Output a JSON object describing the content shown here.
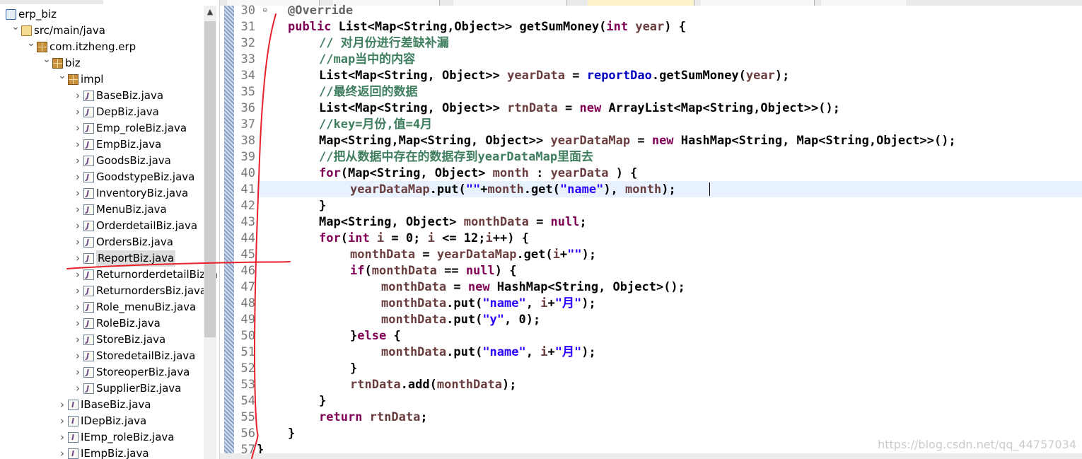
{
  "explorer": {
    "items": [
      {
        "label": "erp_biz",
        "icon": "project-icon",
        "depth": 0,
        "twisty": ""
      },
      {
        "label": "src/main/java",
        "icon": "source-folder-icon",
        "depth": 1,
        "twisty": "expanded"
      },
      {
        "label": "com.itzheng.erp",
        "icon": "package-icon",
        "depth": 2,
        "twisty": "expanded"
      },
      {
        "label": "biz",
        "icon": "package-icon",
        "depth": 3,
        "twisty": "expanded"
      },
      {
        "label": "impl",
        "icon": "package-icon",
        "depth": 4,
        "twisty": "expanded"
      },
      {
        "label": "BaseBiz.java",
        "icon": "java-file-icon",
        "depth": 5,
        "twisty": "collapsed"
      },
      {
        "label": "DepBiz.java",
        "icon": "java-file-icon",
        "depth": 5,
        "twisty": "collapsed"
      },
      {
        "label": "Emp_roleBiz.java",
        "icon": "java-file-icon",
        "depth": 5,
        "twisty": "collapsed"
      },
      {
        "label": "EmpBiz.java",
        "icon": "java-file-icon",
        "depth": 5,
        "twisty": "collapsed"
      },
      {
        "label": "GoodsBiz.java",
        "icon": "java-file-icon",
        "depth": 5,
        "twisty": "collapsed"
      },
      {
        "label": "GoodstypeBiz.java",
        "icon": "java-file-icon",
        "depth": 5,
        "twisty": "collapsed"
      },
      {
        "label": "InventoryBiz.java",
        "icon": "java-file-icon",
        "depth": 5,
        "twisty": "collapsed"
      },
      {
        "label": "MenuBiz.java",
        "icon": "java-file-icon",
        "depth": 5,
        "twisty": "collapsed"
      },
      {
        "label": "OrderdetailBiz.java",
        "icon": "java-file-icon",
        "depth": 5,
        "twisty": "collapsed"
      },
      {
        "label": "OrdersBiz.java",
        "icon": "java-file-icon",
        "depth": 5,
        "twisty": "collapsed"
      },
      {
        "label": "ReportBiz.java",
        "icon": "java-file-icon",
        "depth": 5,
        "twisty": "collapsed",
        "selected": true
      },
      {
        "label": "ReturnorderdetailBiz.ja",
        "icon": "java-file-icon",
        "depth": 5,
        "twisty": "collapsed"
      },
      {
        "label": "ReturnordersBiz.java",
        "icon": "java-file-icon",
        "depth": 5,
        "twisty": "collapsed"
      },
      {
        "label": "Role_menuBiz.java",
        "icon": "java-file-icon",
        "depth": 5,
        "twisty": "collapsed"
      },
      {
        "label": "RoleBiz.java",
        "icon": "java-file-icon",
        "depth": 5,
        "twisty": "collapsed"
      },
      {
        "label": "StoreBiz.java",
        "icon": "java-file-icon",
        "depth": 5,
        "twisty": "collapsed"
      },
      {
        "label": "StoredetailBiz.java",
        "icon": "java-file-icon",
        "depth": 5,
        "twisty": "collapsed"
      },
      {
        "label": "StoreoperBiz.java",
        "icon": "java-file-icon",
        "depth": 5,
        "twisty": "collapsed"
      },
      {
        "label": "SupplierBiz.java",
        "icon": "java-file-icon",
        "depth": 5,
        "twisty": "collapsed"
      },
      {
        "label": "IBaseBiz.java",
        "icon": "interface-file-icon",
        "depth": 4,
        "twisty": "collapsed"
      },
      {
        "label": "IDepBiz.java",
        "icon": "interface-file-icon",
        "depth": 4,
        "twisty": "collapsed"
      },
      {
        "label": "IEmp_roleBiz.java",
        "icon": "interface-file-icon",
        "depth": 4,
        "twisty": "collapsed"
      },
      {
        "label": "IEmpBiz.java",
        "icon": "interface-file-icon",
        "depth": 4,
        "twisty": "collapsed"
      }
    ]
  },
  "editor": {
    "line_numbers": [
      "30",
      "31",
      "32",
      "33",
      "34",
      "35",
      "36",
      "37",
      "38",
      "39",
      "40",
      "41",
      "42",
      "43",
      "44",
      "45",
      "46",
      "47",
      "48",
      "49",
      "50",
      "51",
      "52",
      "53",
      "54",
      "55",
      "56",
      "57"
    ],
    "fold_markers": {
      "30": "⊖"
    },
    "current_line": "41",
    "lines": [
      {
        "indent": 1,
        "tokens": [
          {
            "t": "an",
            "v": "@Override"
          }
        ]
      },
      {
        "indent": 1,
        "tokens": [
          {
            "t": "kw",
            "v": "public"
          },
          {
            "t": "",
            "v": " List<Map<String,Object>> getSumMoney("
          },
          {
            "t": "kw",
            "v": "int"
          },
          {
            "t": "",
            "v": " "
          },
          {
            "t": "lv",
            "v": "year"
          },
          {
            "t": "",
            "v": ") {"
          }
        ]
      },
      {
        "indent": 2,
        "tokens": [
          {
            "t": "cm",
            "v": "// 对月份进行差缺补漏"
          }
        ]
      },
      {
        "indent": 2,
        "tokens": [
          {
            "t": "cm",
            "v": "//map当中的内容"
          }
        ]
      },
      {
        "indent": 2,
        "tokens": [
          {
            "t": "",
            "v": "List<Map<String, Object>> "
          },
          {
            "t": "lv",
            "v": "yearData"
          },
          {
            "t": "",
            "v": " = "
          },
          {
            "t": "fd",
            "v": "reportDao"
          },
          {
            "t": "",
            "v": ".getSumMoney("
          },
          {
            "t": "lv",
            "v": "year"
          },
          {
            "t": "",
            "v": ");"
          }
        ]
      },
      {
        "indent": 2,
        "tokens": [
          {
            "t": "cm",
            "v": "//最终返回的数据"
          }
        ]
      },
      {
        "indent": 2,
        "tokens": [
          {
            "t": "",
            "v": "List<Map<String, Object>> "
          },
          {
            "t": "lv",
            "v": "rtnData"
          },
          {
            "t": "",
            "v": " = "
          },
          {
            "t": "kw",
            "v": "new"
          },
          {
            "t": "",
            "v": " ArrayList<Map<String,Object>>();"
          }
        ]
      },
      {
        "indent": 2,
        "tokens": [
          {
            "t": "cm",
            "v": "//key=月份,值=4月"
          }
        ]
      },
      {
        "indent": 2,
        "tokens": [
          {
            "t": "",
            "v": "Map<String,Map<String, Object>> "
          },
          {
            "t": "lv",
            "v": "yearDataMap"
          },
          {
            "t": "",
            "v": " = "
          },
          {
            "t": "kw",
            "v": "new"
          },
          {
            "t": "",
            "v": " HashMap<String, Map<String,Object>>();"
          }
        ]
      },
      {
        "indent": 2,
        "tokens": [
          {
            "t": "cm",
            "v": "//把从数据中存在的数据存到yearDataMap里面去"
          }
        ]
      },
      {
        "indent": 2,
        "tokens": [
          {
            "t": "kw",
            "v": "for"
          },
          {
            "t": "",
            "v": "(Map<String, Object> "
          },
          {
            "t": "lv",
            "v": "month"
          },
          {
            "t": "",
            "v": " : "
          },
          {
            "t": "lv",
            "v": "yearData"
          },
          {
            "t": "",
            "v": " ) {"
          }
        ]
      },
      {
        "indent": 3,
        "tokens": [
          {
            "t": "lv",
            "v": "yearDataMap"
          },
          {
            "t": "",
            "v": ".put("
          },
          {
            "t": "st",
            "v": "\"\""
          },
          {
            "t": "",
            "v": "+"
          },
          {
            "t": "lv",
            "v": "month"
          },
          {
            "t": "",
            "v": ".get("
          },
          {
            "t": "st",
            "v": "\"name\""
          },
          {
            "t": "",
            "v": "), "
          },
          {
            "t": "lv",
            "v": "month"
          },
          {
            "t": "",
            "v": ");"
          }
        ]
      },
      {
        "indent": 2,
        "tokens": [
          {
            "t": "",
            "v": "}"
          }
        ]
      },
      {
        "indent": 2,
        "tokens": [
          {
            "t": "",
            "v": "Map<String, Object> "
          },
          {
            "t": "lv",
            "v": "monthData"
          },
          {
            "t": "",
            "v": " = "
          },
          {
            "t": "kw",
            "v": "null"
          },
          {
            "t": "",
            "v": ";"
          }
        ]
      },
      {
        "indent": 2,
        "tokens": [
          {
            "t": "kw",
            "v": "for"
          },
          {
            "t": "",
            "v": "("
          },
          {
            "t": "kw",
            "v": "int"
          },
          {
            "t": "",
            "v": " "
          },
          {
            "t": "lv",
            "v": "i"
          },
          {
            "t": "",
            "v": " = 0; "
          },
          {
            "t": "lv",
            "v": "i"
          },
          {
            "t": "",
            "v": " <= 12;"
          },
          {
            "t": "lv",
            "v": "i"
          },
          {
            "t": "",
            "v": "++) {"
          }
        ]
      },
      {
        "indent": 3,
        "tokens": [
          {
            "t": "lv",
            "v": "monthData"
          },
          {
            "t": "",
            "v": " = "
          },
          {
            "t": "lv",
            "v": "yearDataMap"
          },
          {
            "t": "",
            "v": ".get("
          },
          {
            "t": "lv",
            "v": "i"
          },
          {
            "t": "",
            "v": "+"
          },
          {
            "t": "st",
            "v": "\"\""
          },
          {
            "t": "",
            "v": ");"
          }
        ]
      },
      {
        "indent": 3,
        "tokens": [
          {
            "t": "kw",
            "v": "if"
          },
          {
            "t": "",
            "v": "("
          },
          {
            "t": "lv",
            "v": "monthData"
          },
          {
            "t": "",
            "v": " == "
          },
          {
            "t": "kw",
            "v": "null"
          },
          {
            "t": "",
            "v": ") {"
          }
        ]
      },
      {
        "indent": 4,
        "tokens": [
          {
            "t": "lv",
            "v": "monthData"
          },
          {
            "t": "",
            "v": " = "
          },
          {
            "t": "kw",
            "v": "new"
          },
          {
            "t": "",
            "v": " HashMap<String, Object>();"
          }
        ]
      },
      {
        "indent": 4,
        "tokens": [
          {
            "t": "lv",
            "v": "monthData"
          },
          {
            "t": "",
            "v": ".put("
          },
          {
            "t": "st",
            "v": "\"name\""
          },
          {
            "t": "",
            "v": ", "
          },
          {
            "t": "lv",
            "v": "i"
          },
          {
            "t": "",
            "v": "+"
          },
          {
            "t": "st",
            "v": "\"月\""
          },
          {
            "t": "",
            "v": ");"
          }
        ]
      },
      {
        "indent": 4,
        "tokens": [
          {
            "t": "lv",
            "v": "monthData"
          },
          {
            "t": "",
            "v": ".put("
          },
          {
            "t": "st",
            "v": "\"y\""
          },
          {
            "t": "",
            "v": ", 0);"
          }
        ]
      },
      {
        "indent": 3,
        "tokens": [
          {
            "t": "",
            "v": "}"
          },
          {
            "t": "kw",
            "v": "else"
          },
          {
            "t": "",
            "v": " {"
          }
        ]
      },
      {
        "indent": 4,
        "tokens": [
          {
            "t": "lv",
            "v": "monthData"
          },
          {
            "t": "",
            "v": ".put("
          },
          {
            "t": "st",
            "v": "\"name\""
          },
          {
            "t": "",
            "v": ", "
          },
          {
            "t": "lv",
            "v": "i"
          },
          {
            "t": "",
            "v": "+"
          },
          {
            "t": "st",
            "v": "\"月\""
          },
          {
            "t": "",
            "v": ");"
          }
        ]
      },
      {
        "indent": 3,
        "tokens": [
          {
            "t": "",
            "v": "}"
          }
        ]
      },
      {
        "indent": 3,
        "tokens": [
          {
            "t": "lv",
            "v": "rtnData"
          },
          {
            "t": "",
            "v": ".add("
          },
          {
            "t": "lv",
            "v": "monthData"
          },
          {
            "t": "",
            "v": ");"
          }
        ]
      },
      {
        "indent": 2,
        "tokens": [
          {
            "t": "",
            "v": "}"
          }
        ]
      },
      {
        "indent": 2,
        "tokens": [
          {
            "t": "kw",
            "v": "return"
          },
          {
            "t": "",
            "v": " "
          },
          {
            "t": "lv",
            "v": "rtnData"
          },
          {
            "t": "",
            "v": ";"
          }
        ]
      },
      {
        "indent": 1,
        "tokens": [
          {
            "t": "",
            "v": "}"
          }
        ]
      },
      {
        "indent": 0,
        "tokens": [
          {
            "t": "",
            "v": "}"
          }
        ]
      }
    ]
  },
  "watermark": "https://blog.csdn.net/qq_44757034",
  "colors": {
    "keyword": "#7f0055",
    "comment": "#3f7f5f",
    "string": "#2a00ff",
    "annotation": "#646464",
    "local_variable": "#6a3e3e",
    "field": "#0000c0",
    "current_line_highlight": "#e8f2fe",
    "annotation_pen": "#e8202a"
  },
  "icons": [
    "project-icon",
    "source-folder-icon",
    "package-icon",
    "java-file-icon",
    "interface-file-icon",
    "chevron-down-icon",
    "chevron-right-icon",
    "scroll-up-icon",
    "fold-icon"
  ]
}
